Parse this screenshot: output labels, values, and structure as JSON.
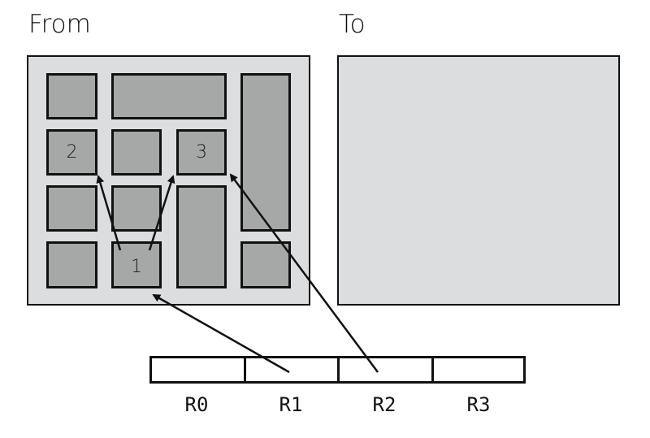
{
  "titles": {
    "from": "From",
    "to": "To"
  },
  "from_panel": {
    "tiles": [
      {
        "id": "t-r1c1",
        "label": ""
      },
      {
        "id": "t-r1c2-wide",
        "label": ""
      },
      {
        "id": "t-c4-tall",
        "label": ""
      },
      {
        "id": "t-r2c1",
        "label": "2"
      },
      {
        "id": "t-r2c2",
        "label": ""
      },
      {
        "id": "t-r2c3",
        "label": "3"
      },
      {
        "id": "t-r3c1",
        "label": ""
      },
      {
        "id": "t-r3c2",
        "label": ""
      },
      {
        "id": "t-c3-tall",
        "label": ""
      },
      {
        "id": "t-r4c1",
        "label": ""
      },
      {
        "id": "t-r4c2",
        "label": "1"
      },
      {
        "id": "t-r4c4",
        "label": ""
      }
    ]
  },
  "to_panel": {
    "tiles": []
  },
  "registers": [
    {
      "label": "R0"
    },
    {
      "label": "R1"
    },
    {
      "label": "R2"
    },
    {
      "label": "R3"
    }
  ],
  "arrows": [
    {
      "from": "tile 1",
      "to": "tile 2"
    },
    {
      "from": "tile 1",
      "to": "tile 3"
    },
    {
      "from": "R1",
      "to": "tile 1"
    },
    {
      "from": "R2",
      "to": "tile 3"
    }
  ],
  "colors": {
    "panel_bg": "#dcddde",
    "tile_fill": "#a5a8a6",
    "stroke": "#111111"
  }
}
